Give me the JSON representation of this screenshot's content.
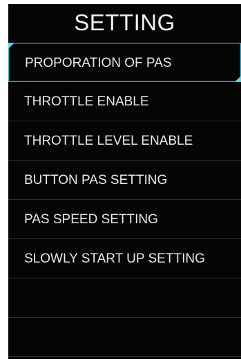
{
  "screen": {
    "title": "SETTING"
  },
  "menu": {
    "items": [
      {
        "label": "PROPORATION OF PAS",
        "selected": true
      },
      {
        "label": "THROTTLE ENABLE"
      },
      {
        "label": "THROTTLE LEVEL ENABLE"
      },
      {
        "label": "BUTTON PAS SETTING"
      },
      {
        "label": "PAS SPEED SETTING"
      },
      {
        "label": "SLOWLY START UP SETTING"
      }
    ]
  },
  "colors": {
    "background": "#050505",
    "text": "#e9e9e9",
    "selection_border": "#3aa6c6",
    "selection_corner": "#5fd2f0",
    "divider": "#2f2f2f"
  }
}
